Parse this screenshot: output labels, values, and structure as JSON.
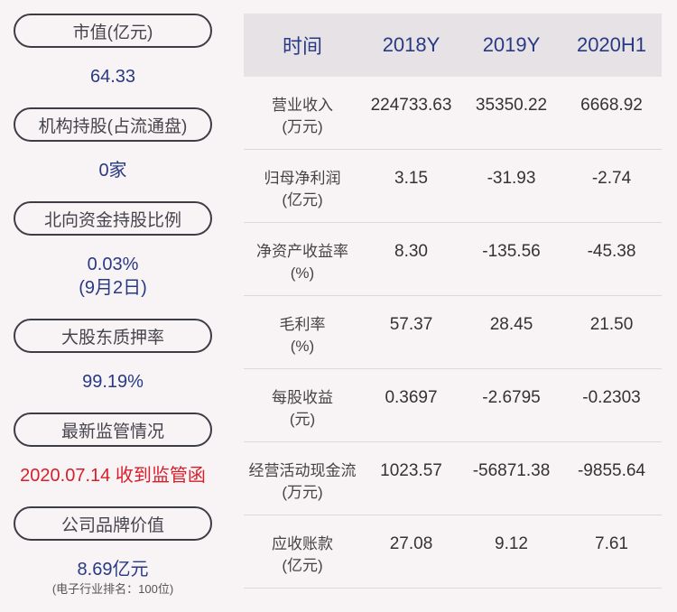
{
  "left": {
    "items": [
      {
        "label": "市值(亿元)",
        "value": "64.33"
      },
      {
        "label": "机构持股(占流通盘)",
        "value": "0家"
      },
      {
        "label": "北向资金持股比例",
        "value": "0.03%",
        "value2": "(9月2日)"
      },
      {
        "label": "大股东质押率",
        "value": "99.19%"
      },
      {
        "label": "最新监管情况",
        "value": "2020.07.14 收到监管函"
      },
      {
        "label": "公司品牌价值",
        "value": "8.69亿元",
        "note": "(电子行业排名：100位)"
      }
    ]
  },
  "table": {
    "headers": [
      "时间",
      "2018Y",
      "2019Y",
      "2020H1"
    ],
    "rows": [
      {
        "label": [
          "营业收入",
          "(万元)"
        ],
        "values": [
          "224733.63",
          "35350.22",
          "6668.92"
        ]
      },
      {
        "label": [
          "归母净利润",
          "(亿元)"
        ],
        "values": [
          "3.15",
          "-31.93",
          "-2.74"
        ]
      },
      {
        "label": [
          "净资产收益率",
          "(%)"
        ],
        "values": [
          "8.30",
          "-135.56",
          "-45.38"
        ]
      },
      {
        "label": [
          "毛利率",
          "(%)"
        ],
        "values": [
          "57.37",
          "28.45",
          "21.50"
        ]
      },
      {
        "label": [
          "每股收益",
          "(元)"
        ],
        "values": [
          "0.3697",
          "-2.6795",
          "-0.2303"
        ]
      },
      {
        "label": [
          "经营活动现金流",
          "(万元)"
        ],
        "values": [
          "1023.57",
          "-56871.38",
          "-9855.64"
        ]
      },
      {
        "label": [
          "应收账款",
          "(亿元)"
        ],
        "values": [
          "27.08",
          "9.12",
          "7.61"
        ]
      }
    ]
  },
  "colors": {
    "accent": "#283a84",
    "alert": "#d81e2a",
    "background": "#f8f3f5",
    "header_bg": "#e6e2e5"
  }
}
